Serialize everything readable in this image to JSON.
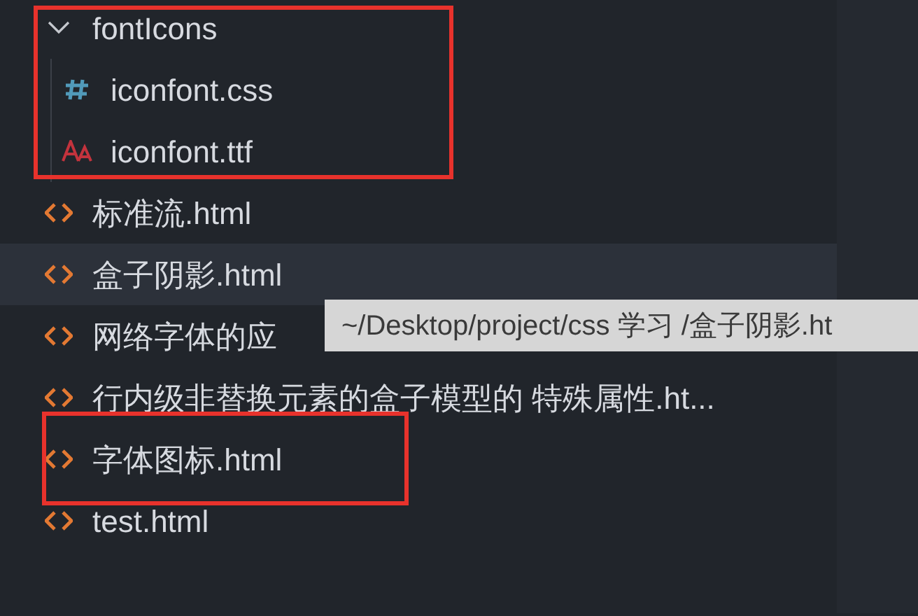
{
  "explorer": {
    "items": [
      {
        "kind": "folder",
        "label": "fontIcons",
        "expanded": true,
        "highlighted": true,
        "hovered": false,
        "children": [
          {
            "kind": "css",
            "label": "iconfont.css",
            "highlighted": false,
            "hovered": false
          },
          {
            "kind": "font",
            "label": "iconfont.ttf",
            "highlighted": false,
            "hovered": false
          }
        ]
      },
      {
        "kind": "html",
        "label": "标准流.html",
        "highlighted": false,
        "hovered": false
      },
      {
        "kind": "html",
        "label": "盒子阴影.html",
        "highlighted": false,
        "hovered": true
      },
      {
        "kind": "html",
        "label": "网络字体的应",
        "highlighted": false,
        "hovered": false
      },
      {
        "kind": "html",
        "label": "行内级非替换元素的盒子模型的 特殊属性.ht...",
        "highlighted": false,
        "hovered": false
      },
      {
        "kind": "html",
        "label": "字体图标.html",
        "highlighted": true,
        "hovered": false
      },
      {
        "kind": "html",
        "label": "test.html",
        "highlighted": false,
        "hovered": false
      }
    ]
  },
  "tooltip": {
    "text": "~/Desktop/project/css 学习 /盒子阴影.ht"
  }
}
